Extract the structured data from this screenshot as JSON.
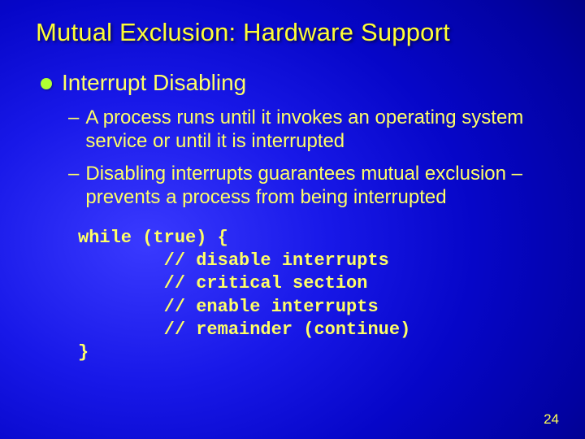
{
  "slide": {
    "title": "Mutual Exclusion: Hardware Support",
    "heading": "Interrupt Disabling",
    "bullets": [
      "A process runs until it invokes an operating system service or until it is interrupted",
      "Disabling interrupts guarantees mutual exclusion – prevents a process from being interrupted"
    ],
    "code": "while (true) {\n        // disable interrupts\n        // critical section\n        // enable interrupts\n        // remainder (continue)\n}",
    "page_number": "24"
  }
}
